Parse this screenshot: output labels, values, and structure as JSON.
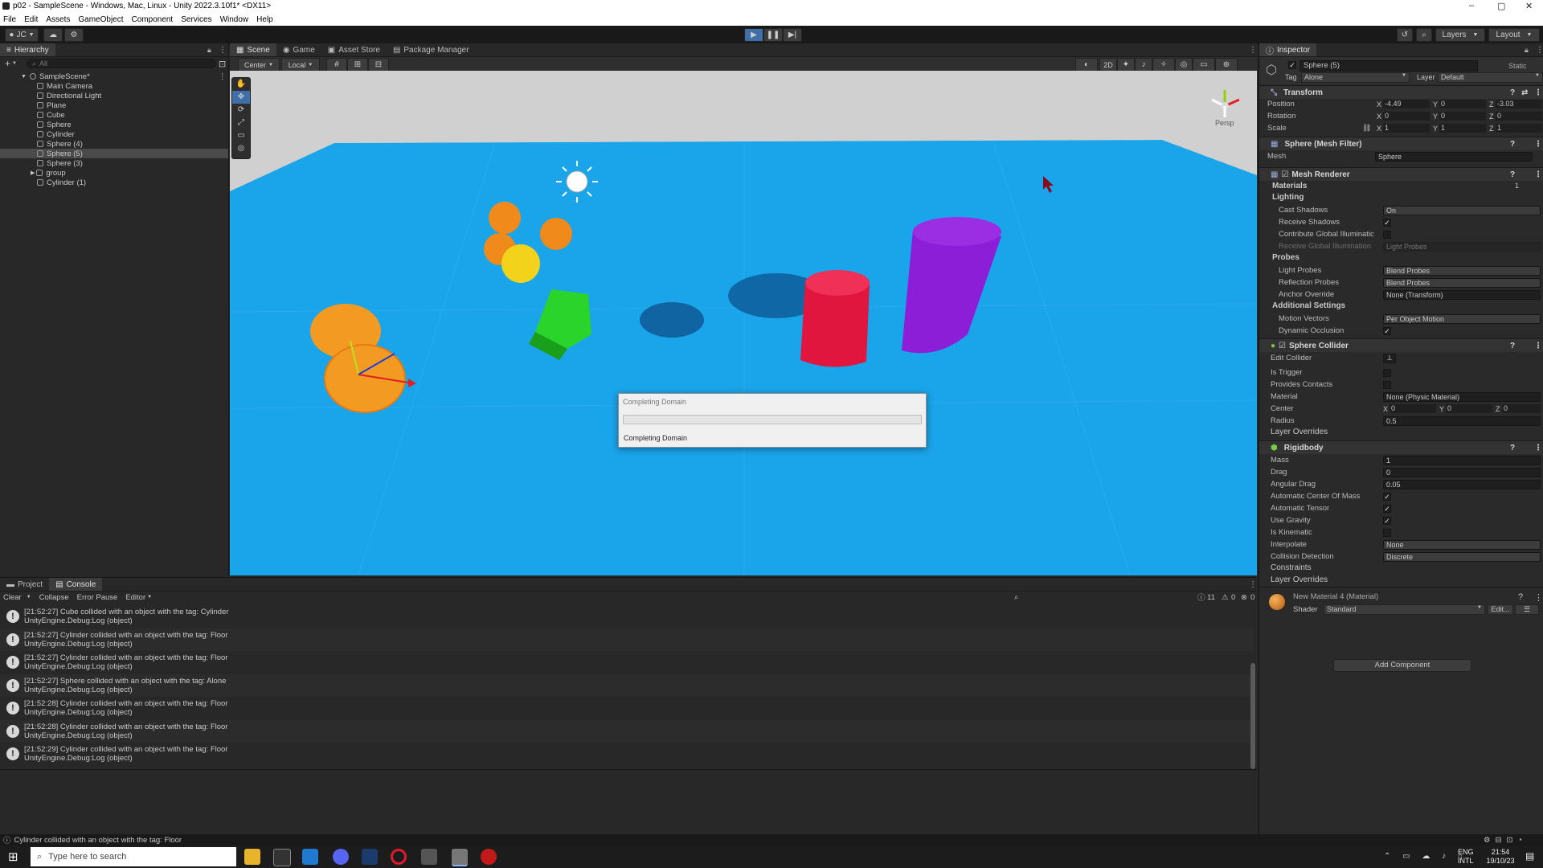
{
  "window": {
    "title": "p02 - SampleScene - Windows, Mac, Linux - Unity 2022.3.10f1* <DX11>",
    "controls": [
      "–",
      "▢",
      "✕"
    ]
  },
  "menu": [
    "File",
    "Edit",
    "Assets",
    "GameObject",
    "Component",
    "Services",
    "Window",
    "Help"
  ],
  "toolbar": {
    "account": "JC",
    "layers": "Layers",
    "layout": "Layout"
  },
  "hierarchy": {
    "tab": "Hierarchy",
    "search_placeholder": "All",
    "items": [
      {
        "label": "SampleScene*"
      },
      {
        "label": "Main Camera"
      },
      {
        "label": "Directional Light"
      },
      {
        "label": "Plane"
      },
      {
        "label": "Cube"
      },
      {
        "label": "Sphere"
      },
      {
        "label": "Cylinder"
      },
      {
        "label": "Sphere (4)"
      },
      {
        "label": "Sphere (5)"
      },
      {
        "label": "Sphere (3)"
      },
      {
        "label": "group"
      },
      {
        "label": "Cylinder (1)"
      }
    ]
  },
  "scene_tabs": [
    "Scene",
    "Game",
    "Asset Store",
    "Package Manager"
  ],
  "scene_toolbar": {
    "pivot": "Center",
    "space": "Local",
    "mode2d": "2D",
    "persp": "Persp"
  },
  "dialog": {
    "title": "Completing Domain",
    "message": "Completing Domain",
    "progress": 0.0
  },
  "inspector": {
    "tab": "Inspector",
    "object_name": "Sphere (5)",
    "static": "Static",
    "tag_label": "Tag",
    "tag": "Alone",
    "layer_label": "Layer",
    "layer": "Default",
    "transform": {
      "title": "Transform",
      "position_label": "Position",
      "rotation_label": "Rotation",
      "scale_label": "Scale",
      "position": {
        "x": "-4.49",
        "y": "0",
        "z": "-3.03"
      },
      "rotation": {
        "x": "0",
        "y": "0",
        "z": "0"
      },
      "scale": {
        "x": "1",
        "y": "1",
        "z": "1"
      }
    },
    "mesh_filter": {
      "title": "Sphere (Mesh Filter)",
      "mesh_label": "Mesh",
      "mesh": "Sphere"
    },
    "mesh_renderer": {
      "title": "Mesh Renderer",
      "materials_label": "Materials",
      "materials_count": "1",
      "lighting_label": "Lighting",
      "cast_shadows_label": "Cast Shadows",
      "cast_shadows": "On",
      "receive_shadows_label": "Receive Shadows",
      "contribute_gi_label": "Contribute Global Illuminatic",
      "receive_gi_label": "Receive Global Illumination",
      "receive_gi": "Light Probes",
      "probes_label": "Probes",
      "light_probes_label": "Light Probes",
      "light_probes": "Blend Probes",
      "reflection_probes_label": "Reflection Probes",
      "reflection_probes": "Blend Probes",
      "anchor_override_label": "Anchor Override",
      "anchor_override": "None (Transform)",
      "additional_label": "Additional Settings",
      "motion_vectors_label": "Motion Vectors",
      "motion_vectors": "Per Object Motion",
      "dynamic_occlusion_label": "Dynamic Occlusion"
    },
    "sphere_collider": {
      "title": "Sphere Collider",
      "edit_collider_label": "Edit Collider",
      "is_trigger_label": "Is Trigger",
      "provides_contacts_label": "Provides Contacts",
      "material_label": "Material",
      "material": "None (Physic Material)",
      "center_label": "Center",
      "center": {
        "x": "0",
        "y": "0",
        "z": "0"
      },
      "radius_label": "Radius",
      "radius": "0.5",
      "layer_overrides_label": "Layer Overrides"
    },
    "rigidbody": {
      "title": "Rigidbody",
      "mass_label": "Mass",
      "mass": "1",
      "drag_label": "Drag",
      "drag": "0",
      "angular_drag_label": "Angular Drag",
      "angular_drag": "0.05",
      "auto_com_label": "Automatic Center Of Mass",
      "auto_tensor_label": "Automatic Tensor",
      "use_gravity_label": "Use Gravity",
      "is_kinematic_label": "Is Kinematic",
      "interpolate_label": "Interpolate",
      "interpolate": "None",
      "collision_label": "Collision Detection",
      "collision": "Discrete",
      "constraints_label": "Constraints",
      "layer_overrides_label": "Layer Overrides"
    },
    "material": {
      "name": "New Material 4 (Material)",
      "shader_label": "Shader",
      "shader": "Standard",
      "edit": "Edit..."
    },
    "add_component": "Add Component"
  },
  "console": {
    "tabs": [
      "Project",
      "Console"
    ],
    "toolbar": [
      "Clear",
      "Collapse",
      "Error Pause",
      "Editor"
    ],
    "counts": {
      "log": "11",
      "warn": "0",
      "error": "0"
    },
    "logs": [
      {
        "line1": "[21:52:27] Cube collided with an object with the tag: Cylinder",
        "line2": "UnityEngine.Debug:Log (object)"
      },
      {
        "line1": "[21:52:27] Cylinder collided with an object with the tag: Floor",
        "line2": "UnityEngine.Debug:Log (object)"
      },
      {
        "line1": "[21:52:27] Cylinder collided with an object with the tag: Floor",
        "line2": "UnityEngine.Debug:Log (object)"
      },
      {
        "line1": "[21:52:27] Sphere collided with an object with the tag: Alone",
        "line2": "UnityEngine.Debug:Log (object)"
      },
      {
        "line1": "[21:52:28] Cylinder collided with an object with the tag: Floor",
        "line2": "UnityEngine.Debug:Log (object)"
      },
      {
        "line1": "[21:52:28] Cylinder collided with an object with the tag: Floor",
        "line2": "UnityEngine.Debug:Log (object)"
      },
      {
        "line1": "[21:52:29] Cylinder collided with an object with the tag: Floor",
        "line2": "UnityEngine.Debug:Log (object)"
      }
    ]
  },
  "status": "Cylinder collided with an object with the tag: Floor",
  "taskbar": {
    "search_placeholder": "Type here to search",
    "lang1": "ENG",
    "lang2": "INTL",
    "time": "21:54",
    "date": "19/10/23"
  },
  "colors": {
    "sky": "#d6d6d6",
    "floor": "#1ea3ea",
    "orange": "#f08a1a",
    "yellow": "#f2d21a",
    "green": "#2bd42b",
    "red": "#e0163f",
    "purple": "#8d1ed8"
  }
}
